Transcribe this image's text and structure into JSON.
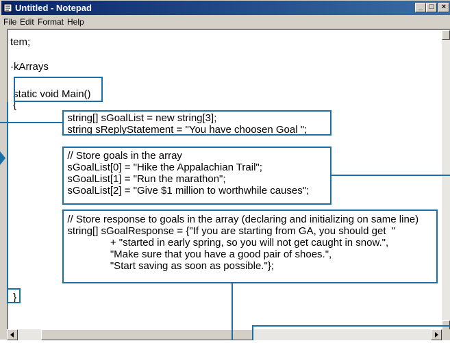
{
  "window": {
    "title": "Untitled - Notepad",
    "buttons": {
      "minimize": "_",
      "maximize": "□",
      "close": "×"
    },
    "icons": {
      "app": "notepad-icon"
    }
  },
  "menu": [
    {
      "label": "File"
    },
    {
      "label": "Edit"
    },
    {
      "label": "Format"
    },
    {
      "label": "Help"
    }
  ],
  "code": {
    "lines": [
      "tem;",
      "",
      "·kArrays",
      "",
      " static void Main()",
      " {",
      "                    string[] sGoalList = new string[3];",
      "                    string sReplyStatement = \"You have choosen Goal \";",
      "",
      "                    // Store goals in the array",
      "                    sGoalList[0] = \"Hike the Appalachian Trail\";",
      "                    sGoalList[1] = \"Run the marathon\";",
      "                    sGoalList[2] = \"Give $1 million to worthwhile causes\";",
      "",
      "                    // Store response to goals in the array (declaring and initializing on same line)",
      "                    string[] sGoalResponse = {\"If you are starting from GA, you should get  \"",
      "                                   + \"started in early spring, so you will not get caught in snow.\",",
      "                                   \"Make sure that you have a good pair of shoes.\",",
      "                                   \"Start saving as soon as possible.\"};",
      "",
      "",
      " }"
    ]
  },
  "colors": {
    "callout": "#1a6fa8",
    "titlebar_start": "#0a246a",
    "titlebar_end": "#3a6ea5"
  }
}
